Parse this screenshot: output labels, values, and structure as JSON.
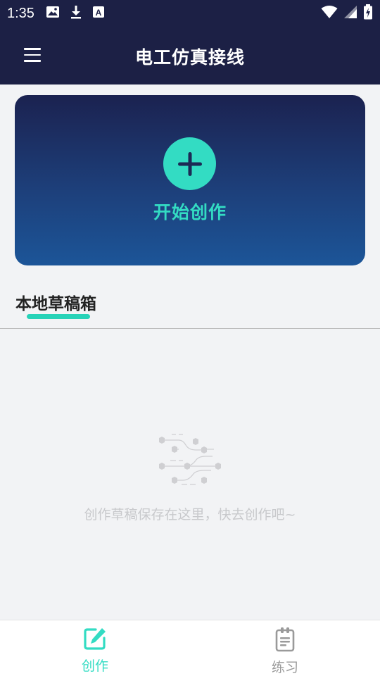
{
  "status_bar": {
    "time": "1:35",
    "icons": [
      "image-icon",
      "download-icon",
      "text-a-icon",
      "wifi-icon",
      "signal-icon",
      "battery-charging-icon"
    ]
  },
  "app_bar": {
    "title": "电工仿真接线",
    "menu_icon": "menu-icon"
  },
  "create_card": {
    "label": "开始创作",
    "icon": "plus-icon"
  },
  "tabs": {
    "drafts_label": "本地草稿箱"
  },
  "empty_state": {
    "message": "创作草稿保存在这里，快去创作吧~",
    "icon": "circuit-illustration-icon"
  },
  "bottom_nav": {
    "items": [
      {
        "label": "创作",
        "icon": "edit-icon",
        "active": true
      },
      {
        "label": "练习",
        "icon": "clipboard-icon",
        "active": false
      }
    ]
  },
  "colors": {
    "header_bg": "#1c2045",
    "accent": "#33dcc3",
    "card_gradient_top": "#1b2250",
    "card_gradient_bottom": "#1c5598",
    "page_bg": "#f2f3f5"
  }
}
